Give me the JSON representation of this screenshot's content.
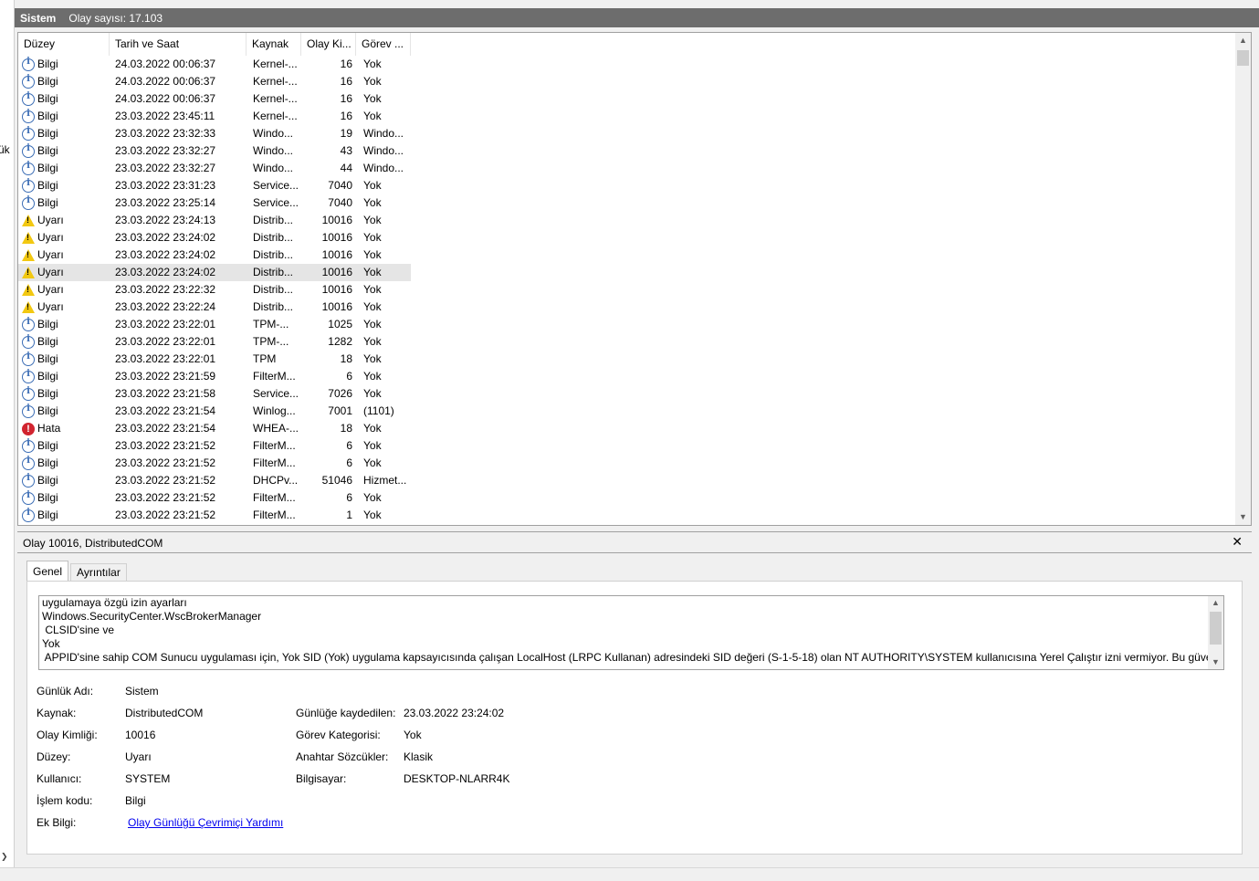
{
  "left_fragment": "ük",
  "header": {
    "title": "Sistem",
    "count": "Olay sayısı: 17.103"
  },
  "columns": [
    "Düzey",
    "Tarih ve Saat",
    "Kaynak",
    "Olay Ki...",
    "Görev ..."
  ],
  "events": [
    {
      "type": "info",
      "level": "Bilgi",
      "date": "24.03.2022 00:06:37",
      "source": "Kernel-...",
      "id": "16",
      "task": "Yok"
    },
    {
      "type": "info",
      "level": "Bilgi",
      "date": "24.03.2022 00:06:37",
      "source": "Kernel-...",
      "id": "16",
      "task": "Yok"
    },
    {
      "type": "info",
      "level": "Bilgi",
      "date": "24.03.2022 00:06:37",
      "source": "Kernel-...",
      "id": "16",
      "task": "Yok"
    },
    {
      "type": "info",
      "level": "Bilgi",
      "date": "23.03.2022 23:45:11",
      "source": "Kernel-...",
      "id": "16",
      "task": "Yok"
    },
    {
      "type": "info",
      "level": "Bilgi",
      "date": "23.03.2022 23:32:33",
      "source": "Windo...",
      "id": "19",
      "task": "Windo..."
    },
    {
      "type": "info",
      "level": "Bilgi",
      "date": "23.03.2022 23:32:27",
      "source": "Windo...",
      "id": "43",
      "task": "Windo..."
    },
    {
      "type": "info",
      "level": "Bilgi",
      "date": "23.03.2022 23:32:27",
      "source": "Windo...",
      "id": "44",
      "task": "Windo..."
    },
    {
      "type": "info",
      "level": "Bilgi",
      "date": "23.03.2022 23:31:23",
      "source": "Service...",
      "id": "7040",
      "task": "Yok"
    },
    {
      "type": "info",
      "level": "Bilgi",
      "date": "23.03.2022 23:25:14",
      "source": "Service...",
      "id": "7040",
      "task": "Yok"
    },
    {
      "type": "warn",
      "level": "Uyarı",
      "date": "23.03.2022 23:24:13",
      "source": "Distrib...",
      "id": "10016",
      "task": "Yok"
    },
    {
      "type": "warn",
      "level": "Uyarı",
      "date": "23.03.2022 23:24:02",
      "source": "Distrib...",
      "id": "10016",
      "task": "Yok"
    },
    {
      "type": "warn",
      "level": "Uyarı",
      "date": "23.03.2022 23:24:02",
      "source": "Distrib...",
      "id": "10016",
      "task": "Yok"
    },
    {
      "type": "warn",
      "level": "Uyarı",
      "date": "23.03.2022 23:24:02",
      "source": "Distrib...",
      "id": "10016",
      "task": "Yok",
      "selected": true
    },
    {
      "type": "warn",
      "level": "Uyarı",
      "date": "23.03.2022 23:22:32",
      "source": "Distrib...",
      "id": "10016",
      "task": "Yok"
    },
    {
      "type": "warn",
      "level": "Uyarı",
      "date": "23.03.2022 23:22:24",
      "source": "Distrib...",
      "id": "10016",
      "task": "Yok"
    },
    {
      "type": "info",
      "level": "Bilgi",
      "date": "23.03.2022 23:22:01",
      "source": "TPM-...",
      "id": "1025",
      "task": "Yok"
    },
    {
      "type": "info",
      "level": "Bilgi",
      "date": "23.03.2022 23:22:01",
      "source": "TPM-...",
      "id": "1282",
      "task": "Yok"
    },
    {
      "type": "info",
      "level": "Bilgi",
      "date": "23.03.2022 23:22:01",
      "source": "TPM",
      "id": "18",
      "task": "Yok"
    },
    {
      "type": "info",
      "level": "Bilgi",
      "date": "23.03.2022 23:21:59",
      "source": "FilterM...",
      "id": "6",
      "task": "Yok"
    },
    {
      "type": "info",
      "level": "Bilgi",
      "date": "23.03.2022 23:21:58",
      "source": "Service...",
      "id": "7026",
      "task": "Yok"
    },
    {
      "type": "info",
      "level": "Bilgi",
      "date": "23.03.2022 23:21:54",
      "source": "Winlog...",
      "id": "7001",
      "task": "(1101)"
    },
    {
      "type": "err",
      "level": "Hata",
      "date": "23.03.2022 23:21:54",
      "source": "WHEA-...",
      "id": "18",
      "task": "Yok"
    },
    {
      "type": "info",
      "level": "Bilgi",
      "date": "23.03.2022 23:21:52",
      "source": "FilterM...",
      "id": "6",
      "task": "Yok"
    },
    {
      "type": "info",
      "level": "Bilgi",
      "date": "23.03.2022 23:21:52",
      "source": "FilterM...",
      "id": "6",
      "task": "Yok"
    },
    {
      "type": "info",
      "level": "Bilgi",
      "date": "23.03.2022 23:21:52",
      "source": "DHCPv...",
      "id": "51046",
      "task": "Hizmet..."
    },
    {
      "type": "info",
      "level": "Bilgi",
      "date": "23.03.2022 23:21:52",
      "source": "FilterM...",
      "id": "6",
      "task": "Yok"
    },
    {
      "type": "info",
      "level": "Bilgi",
      "date": "23.03.2022 23:21:52",
      "source": "FilterM...",
      "id": "1",
      "task": "Yok"
    }
  ],
  "details": {
    "title": "Olay 10016, DistributedCOM",
    "close": "✕",
    "tabs": [
      "Genel",
      "Ayrıntılar"
    ],
    "description": [
      "uygulamaya özgü izin ayarları",
      "Windows.SecurityCenter.WscBrokerManager",
      " CLSID'sine ve",
      "Yok",
      " APPID'sine sahip COM Sunucu uygulaması için, Yok SID (Yok) uygulama kapsayıcısında çalışan LocalHost (LRPC Kullanan) adresindeki SID değeri (S-1-5-18) olan NT AUTHORITY\\SYSTEM kullanıcısına Yerel Çalıştır izni vermiyor. Bu güvenlik"
    ],
    "labels": {
      "log_name": "Günlük Adı:",
      "source": "Kaynak:",
      "event_id": "Olay Kimliği:",
      "level": "Düzey:",
      "user": "Kullanıcı:",
      "opcode": "İşlem kodu:",
      "more_info": "Ek Bilgi:",
      "logged": "Günlüğe kaydedilen:",
      "task_category": "Görev Kategorisi:",
      "keywords": "Anahtar Sözcükler:",
      "computer": "Bilgisayar:"
    },
    "values": {
      "log_name": "Sistem",
      "source": "DistributedCOM",
      "event_id": "10016",
      "level": "Uyarı",
      "user": "SYSTEM",
      "opcode": "Bilgi",
      "more_info_link": "Olay Günlüğü Çevrimiçi Yardımı",
      "logged": "23.03.2022 23:24:02",
      "task_category": "Yok",
      "keywords": "Klasik",
      "computer": "DESKTOP-NLARR4K"
    }
  },
  "icons": {
    "scroll_up": "▲",
    "scroll_down": "▼",
    "expand": "❯"
  },
  "colors": {
    "header_bg": "#6d6d6d",
    "selected_row": "#e5e5e5",
    "link": "#0000ee",
    "info": "#3b6db5",
    "warn": "#f2c811",
    "err": "#d1242f"
  }
}
